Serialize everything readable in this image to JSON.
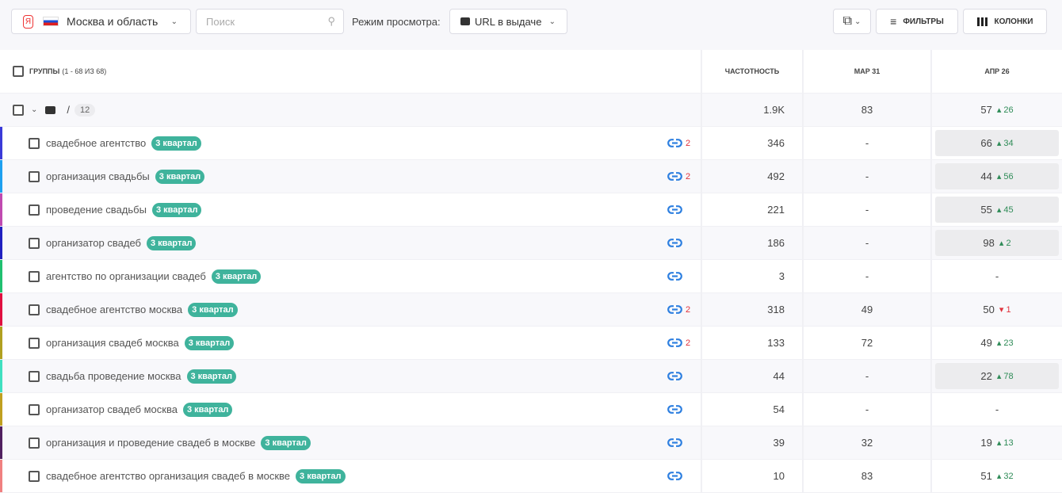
{
  "toolbar": {
    "region": "Москва и область",
    "search_placeholder": "Поиск",
    "view_mode_label": "Режим просмотра:",
    "view_mode_value": "URL в выдаче",
    "filters": "ФИЛЬТРЫ",
    "columns": "КОЛОНКИ"
  },
  "header": {
    "groups": "ГРУППЫ",
    "groups_range": "(1 - 68 ИЗ 68)",
    "frequency": "ЧАСТОТНОСТЬ",
    "col_mar": "МАР 31",
    "col_apr": "АПР 26"
  },
  "group_row": {
    "path": "/",
    "count": "12",
    "frequency": "1.9K",
    "mar": "83",
    "apr": "57",
    "apr_change": "26"
  },
  "rows": [
    {
      "keyword": "свадебное агентство",
      "tag": "3 квартал",
      "url_count": "2",
      "frequency": "346",
      "mar": "-",
      "apr": "66",
      "apr_change": "34",
      "dir": "up",
      "hl": true,
      "color": "#3a3ad8"
    },
    {
      "keyword": "организация свадьбы",
      "tag": "3 квартал",
      "url_count": "2",
      "frequency": "492",
      "mar": "-",
      "apr": "44",
      "apr_change": "56",
      "dir": "up",
      "hl": true,
      "color": "#1ea0f0"
    },
    {
      "keyword": "проведение свадьбы",
      "tag": "3 квартал",
      "url_count": "",
      "frequency": "221",
      "mar": "-",
      "apr": "55",
      "apr_change": "45",
      "dir": "up",
      "hl": true,
      "color": "#c04ab0"
    },
    {
      "keyword": "организатор свадеб",
      "tag": "3 квартал",
      "url_count": "",
      "frequency": "186",
      "mar": "-",
      "apr": "98",
      "apr_change": "2",
      "dir": "up",
      "hl": true,
      "color": "#2020c0"
    },
    {
      "keyword": "агентство по организации свадеб",
      "tag": "3 квартал",
      "url_count": "",
      "frequency": "3",
      "mar": "-",
      "apr": "-",
      "apr_change": "",
      "dir": "",
      "hl": false,
      "color": "#20c070"
    },
    {
      "keyword": "свадебное агентство москва",
      "tag": "3 квартал",
      "url_count": "2",
      "frequency": "318",
      "mar": "49",
      "apr": "50",
      "apr_change": "1",
      "dir": "down",
      "hl": false,
      "color": "#e01040"
    },
    {
      "keyword": "организация свадеб москва",
      "tag": "3 квартал",
      "url_count": "2",
      "frequency": "133",
      "mar": "72",
      "apr": "49",
      "apr_change": "23",
      "dir": "up",
      "hl": false,
      "color": "#b0a020"
    },
    {
      "keyword": "свадьба проведение москва",
      "tag": "3 квартал",
      "url_count": "",
      "frequency": "44",
      "mar": "-",
      "apr": "22",
      "apr_change": "78",
      "dir": "up",
      "hl": true,
      "color": "#40e0c0"
    },
    {
      "keyword": "организатор свадеб москва",
      "tag": "3 квартал",
      "url_count": "",
      "frequency": "54",
      "mar": "-",
      "apr": "-",
      "apr_change": "",
      "dir": "",
      "hl": false,
      "color": "#c0a020"
    },
    {
      "keyword": "организация и проведение свадеб в москве",
      "tag": "3 квартал",
      "url_count": "",
      "frequency": "39",
      "mar": "32",
      "apr": "19",
      "apr_change": "13",
      "dir": "up",
      "hl": false,
      "color": "#502060"
    },
    {
      "keyword": "свадебное агентство организация свадеб в москве",
      "tag": "3 квартал",
      "url_count": "",
      "frequency": "10",
      "mar": "83",
      "apr": "51",
      "apr_change": "32",
      "dir": "up",
      "hl": false,
      "color": "#f08080"
    }
  ]
}
